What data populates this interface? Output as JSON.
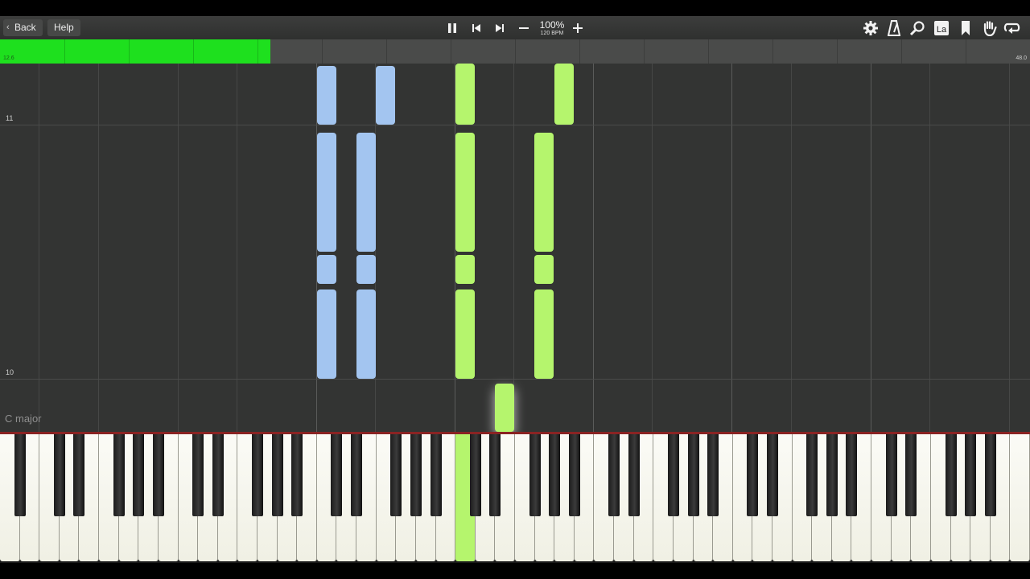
{
  "toolbar": {
    "back_label": "Back",
    "help_label": "Help",
    "zoom": "100%",
    "tempo": "120 BPM",
    "icons": [
      "pause-icon",
      "skip-back-icon",
      "skip-forward-icon",
      "zoom-out-icon",
      "zoom-in-icon",
      "settings-gear-icon",
      "metronome-icon",
      "search-icon",
      "note-label-icon",
      "bookmark-icon",
      "hand-icon",
      "loop-icon"
    ]
  },
  "progress": {
    "current": "12.6",
    "total": "48.0",
    "fraction": 0.2625,
    "color": "#1ee01e"
  },
  "roll": {
    "measures": [
      "11",
      "10"
    ],
    "key_signature": "C major",
    "colors": {
      "left_hand": "#a3c5f0",
      "right_hand": "#b5f56d"
    }
  },
  "keyboard": {
    "white_keys": 52,
    "active_key": "C4"
  }
}
